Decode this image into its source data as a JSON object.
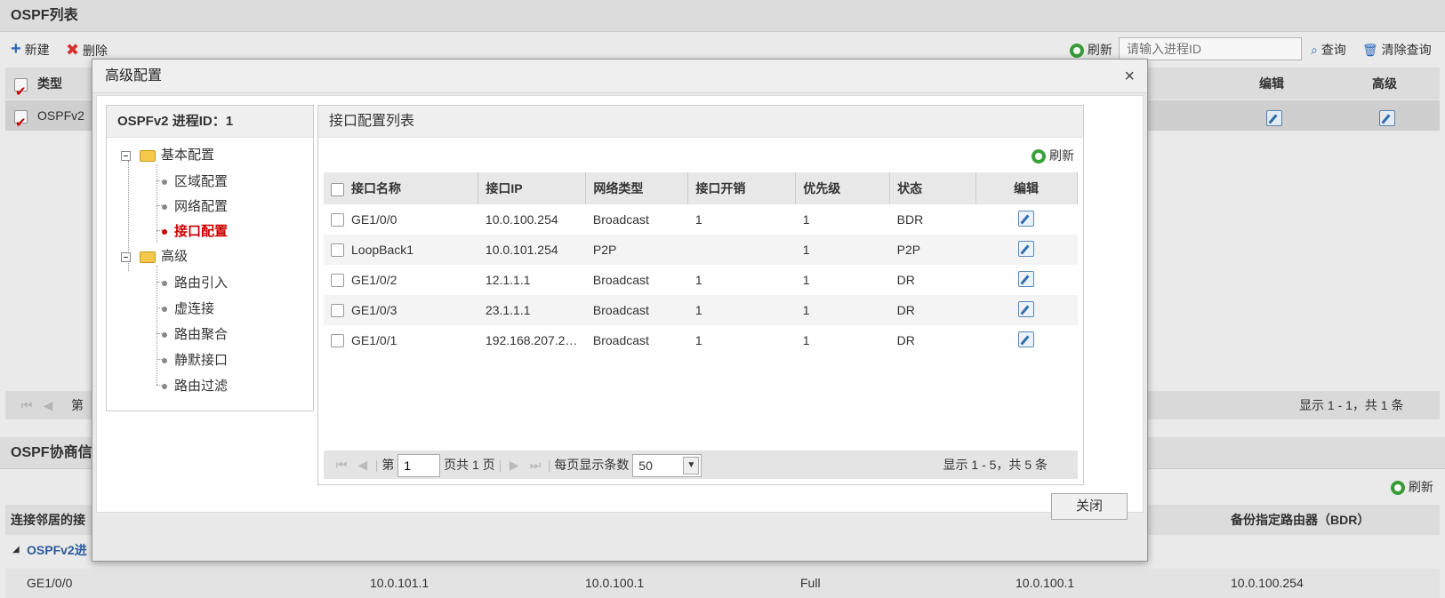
{
  "background": {
    "list_title": "OSPF列表",
    "new_label": "新建",
    "delete_label": "删除",
    "refresh_label": "刷新",
    "search_placeholder": "请输入进程ID",
    "query_label": "查询",
    "clear_query_label": "清除查询",
    "col_type": "类型",
    "col_edit": "编辑",
    "col_advanced": "高级",
    "row_type": "OSPFv2",
    "pager_first": "第",
    "pager_summary": "显示 1 - 1，共 1 条",
    "neighbor_title": "OSPF协商信",
    "neighbor_refresh": "刷新",
    "neighbor_col_first": "连接邻居的接",
    "neighbor_col_bdr": "备份指定路由器（BDR）",
    "group_label": "OSPFv2进",
    "neighbor_row": [
      "GE1/0/0",
      "10.0.101.1",
      "10.0.100.1",
      "Full",
      "10.0.100.1",
      "10.0.100.254"
    ]
  },
  "modal": {
    "title": "高级配置",
    "close_icon": "×",
    "close_button": "关闭",
    "tree": {
      "header": "OSPFv2 进程ID：1",
      "groups": [
        {
          "label": "基本配置",
          "items": [
            "区域配置",
            "网络配置",
            "接口配置"
          ]
        },
        {
          "label": "高级",
          "items": [
            "路由引入",
            "虚连接",
            "路由聚合",
            "静默接口",
            "路由过滤"
          ]
        }
      ]
    },
    "panel": {
      "title": "接口配置列表",
      "refresh_label": "刷新",
      "columns": [
        "接口名称",
        "接口IP",
        "网络类型",
        "接口开销",
        "优先级",
        "状态",
        "编辑"
      ],
      "rows": [
        [
          "GE1/0/0",
          "10.0.100.254",
          "Broadcast",
          "1",
          "1",
          "BDR"
        ],
        [
          "LoopBack1",
          "10.0.101.254",
          "P2P",
          "",
          "1",
          "P2P"
        ],
        [
          "GE1/0/2",
          "12.1.1.1",
          "Broadcast",
          "1",
          "1",
          "DR"
        ],
        [
          "GE1/0/3",
          "23.1.1.1",
          "Broadcast",
          "1",
          "1",
          "DR"
        ],
        [
          "GE1/0/1",
          "192.168.207.2…",
          "Broadcast",
          "1",
          "1",
          "DR"
        ]
      ],
      "pager": {
        "page_prefix": "第",
        "page_value": "1",
        "page_suffix": "页共 1 页",
        "per_page_label": "每页显示条数",
        "per_page_value": "50",
        "summary": "显示 1 - 5，共 5 条"
      }
    }
  },
  "colors": {
    "accent_red": "#cc0000",
    "refresh_green": "#3aa13a",
    "header_gray": "#e4e4e4"
  }
}
